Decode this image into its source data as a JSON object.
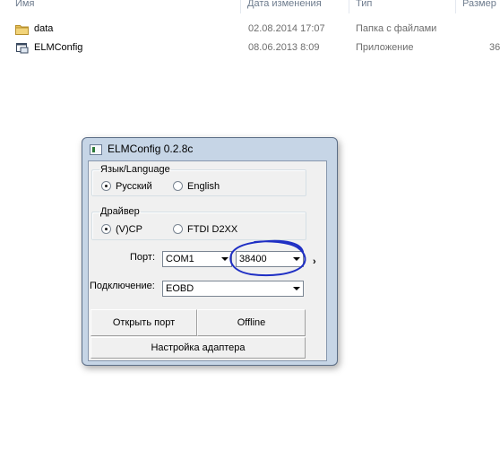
{
  "explorer": {
    "columns": {
      "name": "Имя",
      "date": "Дата изменения",
      "type": "Тип",
      "size": "Размер"
    },
    "files": [
      {
        "name": "data",
        "date": "02.08.2014 17:07",
        "type": "Папка с файлами",
        "size": "",
        "icon": "folder-icon"
      },
      {
        "name": "ELMConfig",
        "date": "08.06.2013 8:09",
        "type": "Приложение",
        "size": "36",
        "icon": "application-icon"
      }
    ]
  },
  "window": {
    "title": "ELMConfig 0.2.8c",
    "language_group": {
      "legend": "Язык/Language",
      "options": [
        {
          "label": "Русский",
          "selected": true
        },
        {
          "label": "English",
          "selected": false
        }
      ]
    },
    "driver_group": {
      "legend": "Драйвер",
      "options": [
        {
          "label": "(V)CP",
          "selected": true
        },
        {
          "label": "FTDI D2XX",
          "selected": false
        }
      ]
    },
    "port_label": "Порт:",
    "port_value": "COM1",
    "baud_value": "38400",
    "connection_label": "Подключение:",
    "connection_value": "EOBD",
    "open_port_label": "Открыть порт",
    "offline_label": "Offline",
    "adapter_settings_label": "Настройка адаптера",
    "expand_arrow": "›"
  },
  "colors": {
    "window_frame": "#c6d5e6",
    "annotation_ink": "#1f2fc4"
  }
}
